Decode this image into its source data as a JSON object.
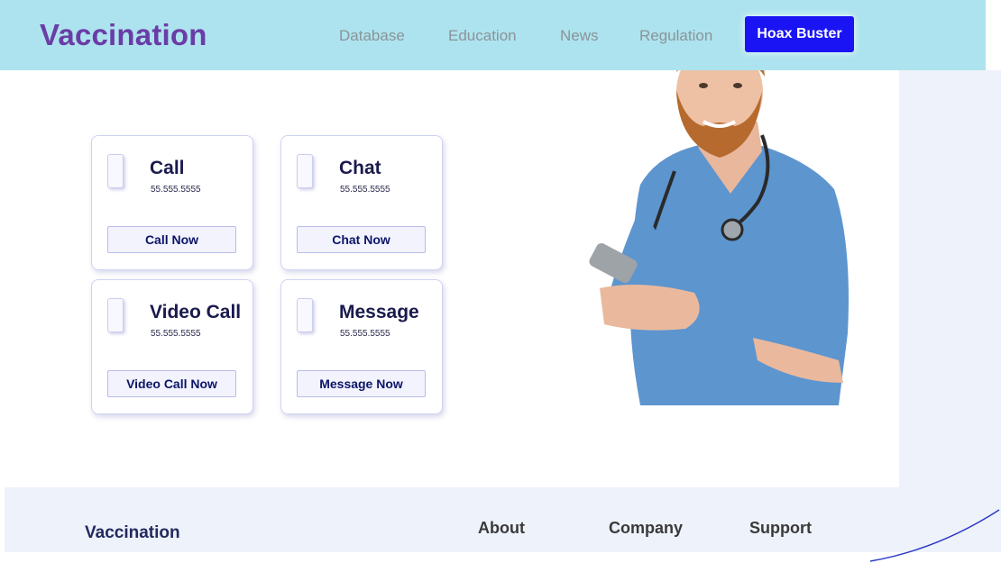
{
  "header": {
    "logo": "Vaccination",
    "nav": [
      "Database",
      "Education",
      "News",
      "Regulation"
    ],
    "cta": "Hoax Buster"
  },
  "contacts": [
    {
      "title": "Call",
      "number": "55.555.5555",
      "button": "Call Now"
    },
    {
      "title": "Chat",
      "number": "55.555.5555",
      "button": "Chat Now"
    },
    {
      "title": "Video Call",
      "number": "55.555.5555",
      "button": "Video Call Now"
    },
    {
      "title": "Message",
      "number": "55.555.5555",
      "button": "Message Now"
    }
  ],
  "footer": {
    "brand": "Vaccination",
    "columns": [
      "About",
      "Company",
      "Support"
    ]
  },
  "colors": {
    "header_bg": "#ade3ee",
    "logo": "#6a3da6",
    "cta_bg": "#1a14f5",
    "card_text": "#1a1a4e",
    "button_text": "#0c1566",
    "footer_bg": "#eef2fb"
  },
  "icons": [
    "contact-icon",
    "doctor-illustration"
  ]
}
